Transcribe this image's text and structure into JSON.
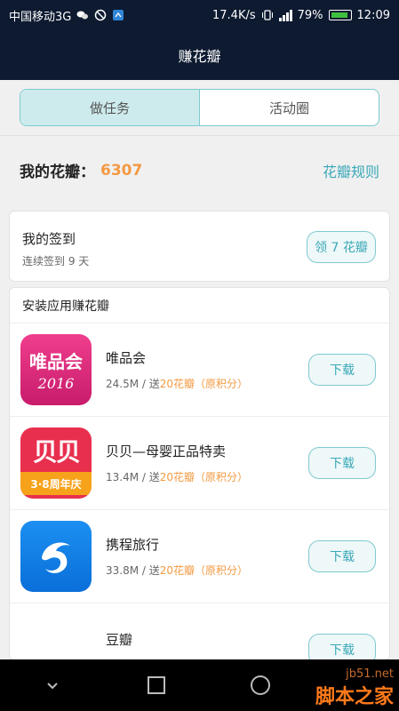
{
  "status_bar": {
    "carrier": "中国移动3G",
    "speed": "17.4K/s",
    "battery": "79%",
    "time": "12:09",
    "network": "3G"
  },
  "title_bar": {
    "title": "赚花瓣"
  },
  "tabs": [
    {
      "label": "做任务",
      "active": true
    },
    {
      "label": "活动圈",
      "active": false
    }
  ],
  "petals": {
    "label": "我的花瓣：",
    "count": "6307",
    "rules_link": "花瓣规则"
  },
  "signin": {
    "title": "我的签到",
    "subtitle": "连续签到 9 天",
    "button": "领 7 花瓣"
  },
  "apps_section": {
    "header": "安装应用赚花瓣",
    "items": [
      {
        "name": "唯品会",
        "size": "24.5M",
        "sep": " / ",
        "gift_prefix": "送",
        "gift": "20花瓣（原积分）",
        "button": "下载",
        "icon_name": "vipshop-app-icon",
        "icon_text": "唯品会",
        "icon_year": "2016"
      },
      {
        "name": "贝贝—母婴正品特卖",
        "size": "13.4M",
        "sep": " / ",
        "gift_prefix": "送",
        "gift": "20花瓣（原积分）",
        "button": "下载",
        "icon_name": "beibei-app-icon",
        "icon_text": "贝贝",
        "icon_badge": "3·8周年庆"
      },
      {
        "name": "携程旅行",
        "size": "33.8M",
        "sep": " / ",
        "gift_prefix": "送",
        "gift": "20花瓣（原积分）",
        "button": "下载",
        "icon_name": "ctrip-app-icon"
      },
      {
        "name": "豆瓣",
        "button": "下载",
        "icon_name": "douban-app-icon"
      }
    ]
  },
  "watermark": {
    "line1": "jb51.net",
    "line2": "脚本之家"
  },
  "colors": {
    "accent": "#3aa8b8",
    "orange": "#f39a43",
    "header_bg": "#0d1a30"
  }
}
